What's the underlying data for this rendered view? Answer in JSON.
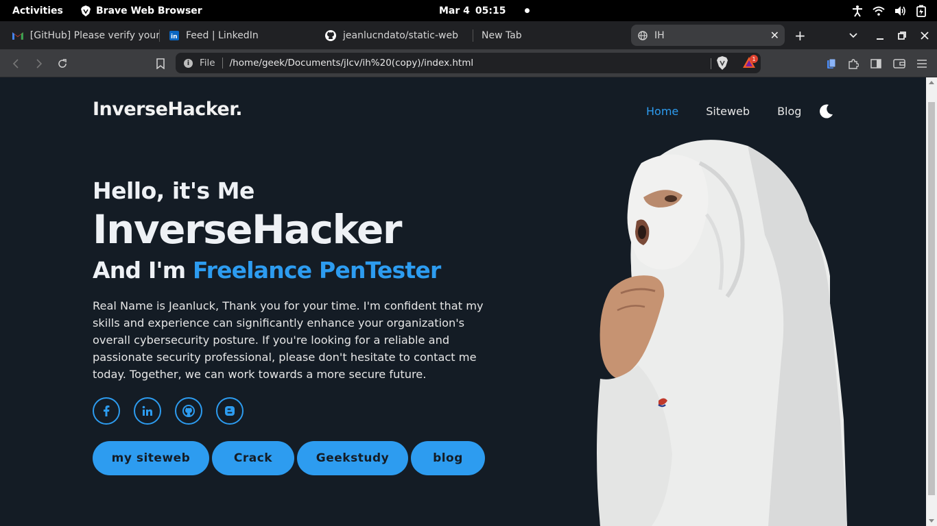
{
  "topbar": {
    "activities": "Activities",
    "app_name": "Brave Web Browser",
    "date": "Mar 4",
    "time": "05:15"
  },
  "tabs": [
    {
      "title": "[GitHub] Please verify your",
      "icon": "gmail-icon"
    },
    {
      "title": "Feed | LinkedIn",
      "icon": "linkedin-icon"
    },
    {
      "title": "jeanlucndato/static-web",
      "icon": "github-icon"
    },
    {
      "title": "New Tab",
      "icon": ""
    },
    {
      "title": "IH",
      "icon": "globe-icon",
      "active": true
    }
  ],
  "toolbar": {
    "url_scheme": "File",
    "url": "/home/geek/Documents/jlcv/ih%20(copy)/index.html",
    "rewards_badge": "1"
  },
  "site": {
    "logo": "InverseHacker.",
    "nav": [
      "Home",
      "Siteweb",
      "Blog"
    ],
    "hello": "Hello, it's Me",
    "name": "InverseHacker",
    "role_prefix": "And I'm ",
    "role_highlight": "Freelance PenTester",
    "bio": "Real Name is Jeanluck, Thank you for your time. I'm confident that my skills and experience can significantly enhance your organization's overall cybersecurity posture. If you're looking for a reliable and passionate security professional, please don't hesitate to contact me today. Together, we can work towards a more secure future.",
    "socials": [
      "facebook-icon",
      "linkedin-icon",
      "github-icon",
      "blogger-icon"
    ],
    "buttons": [
      "my siteweb",
      "Crack",
      "Geekstudy",
      "blog"
    ]
  },
  "colors": {
    "accent": "#2d9cf0",
    "page_bg": "#141c25"
  }
}
